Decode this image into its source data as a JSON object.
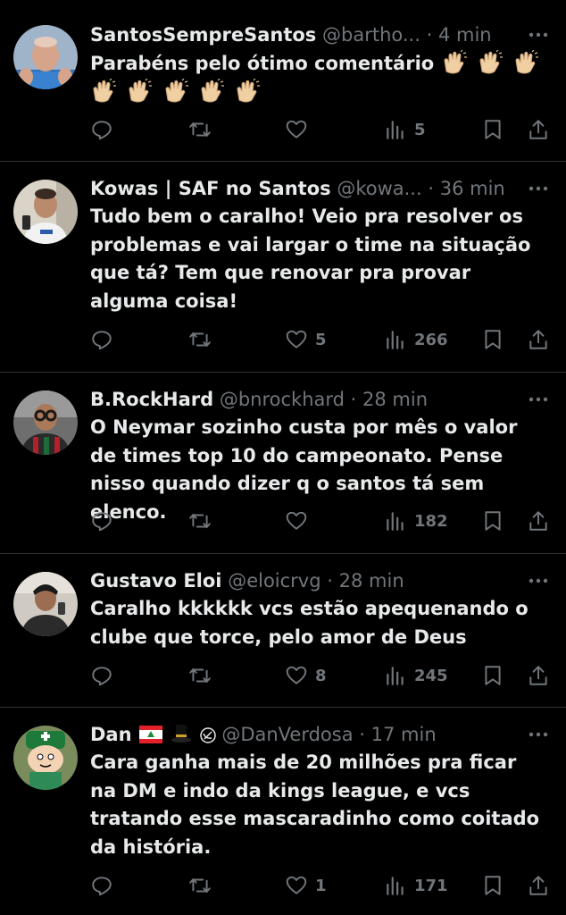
{
  "tweets": [
    {
      "name": "SantosSempreSantos",
      "handle": "@bartho...",
      "time": "4 min",
      "text": "Parabéns pelo ótimo comentário",
      "replies": "",
      "retweets": "",
      "likes": "",
      "views": "5",
      "claps": 8
    },
    {
      "name": "Kowas | SAF no Santos",
      "handle": "@kowa...",
      "time": "36 min",
      "text": "Tudo bem o caralho! Veio pra resolver os problemas e vai largar o time na situação que tá? Tem que renovar pra provar alguma coisa!",
      "replies": "",
      "retweets": "",
      "likes": "5",
      "views": "266"
    },
    {
      "name": "B.RockHard",
      "handle": "@bnrockhard",
      "time": "28 min",
      "text": "O Neymar sozinho custa por mês o valor de times top 10 do campeonato. Pense nisso quando dizer q o santos tá sem elenco.",
      "replies": "",
      "retweets": "",
      "likes": "",
      "views": "182"
    },
    {
      "name": "Gustavo Eloi",
      "handle": "@eloicrvg",
      "time": "28 min",
      "text": "Caralho kkkkkk vcs estão apequenando o clube que torce, pelo amor de Deus",
      "replies": "",
      "retweets": "",
      "likes": "8",
      "views": "245"
    },
    {
      "name": "Dan",
      "handle": "@DanVerdosa",
      "time": "17 min",
      "text": "Cara ganha mais de 20 milhões pra ficar na DM e indo da kings league, e vcs tratando esse mascaradinho como coitado da história.",
      "replies": "",
      "retweets": "",
      "likes": "1",
      "views": "171"
    }
  ],
  "separator": "·",
  "colors": {
    "background": "#000000",
    "text": "#e7e9ea",
    "secondary": "#71767b",
    "divider": "#2f3336"
  },
  "icons": [
    "reply-icon",
    "retweet-icon",
    "like-icon",
    "views-icon",
    "bookmark-icon",
    "share-icon",
    "more-icon",
    "clap-emoji"
  ]
}
